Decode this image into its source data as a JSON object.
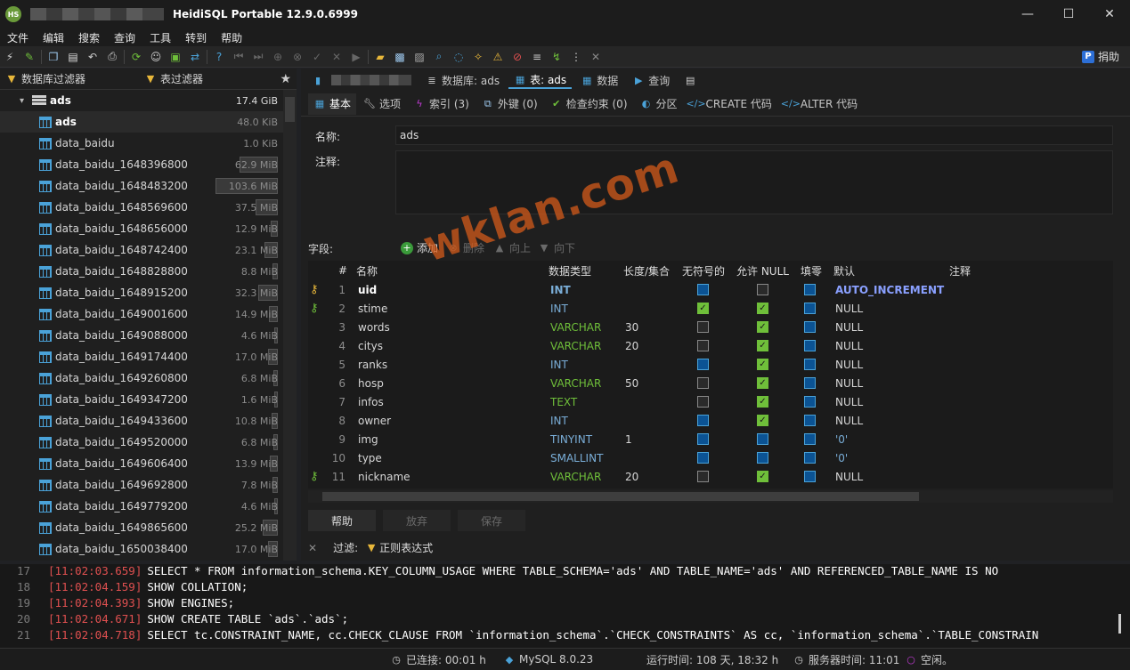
{
  "window": {
    "title": "HeidiSQL Portable 12.9.0.6999",
    "app_icon_text": "HS",
    "minimize": "—",
    "maximize": "☐",
    "close": "✕"
  },
  "menu": [
    "文件",
    "编辑",
    "搜索",
    "查询",
    "工具",
    "转到",
    "帮助"
  ],
  "toolbar": {
    "donate_label": "捐助",
    "paypal_text": "P"
  },
  "left": {
    "db_filter_label": "数据库过滤器",
    "table_filter_label": "表过滤器",
    "database": {
      "name": "ads",
      "size": "17.4 GiB"
    },
    "tables": [
      {
        "name": "ads",
        "size": "48.0 KiB",
        "fill": 0
      },
      {
        "name": "data_baidu",
        "size": "1.0 KiB",
        "fill": 0
      },
      {
        "name": "data_baidu_1648396800",
        "size": "62.9 MiB",
        "fill": 0.61
      },
      {
        "name": "data_baidu_1648483200",
        "size": "103.6 MiB",
        "fill": 1.0
      },
      {
        "name": "data_baidu_1648569600",
        "size": "37.5 MiB",
        "fill": 0.36
      },
      {
        "name": "data_baidu_1648656000",
        "size": "12.9 MiB",
        "fill": 0.12
      },
      {
        "name": "data_baidu_1648742400",
        "size": "23.1 MiB",
        "fill": 0.22
      },
      {
        "name": "data_baidu_1648828800",
        "size": "8.8 MiB",
        "fill": 0.08
      },
      {
        "name": "data_baidu_1648915200",
        "size": "32.3 MiB",
        "fill": 0.31
      },
      {
        "name": "data_baidu_1649001600",
        "size": "14.9 MiB",
        "fill": 0.14
      },
      {
        "name": "data_baidu_1649088000",
        "size": "4.6 MiB",
        "fill": 0.04
      },
      {
        "name": "data_baidu_1649174400",
        "size": "17.0 MiB",
        "fill": 0.16
      },
      {
        "name": "data_baidu_1649260800",
        "size": "6.8 MiB",
        "fill": 0.07
      },
      {
        "name": "data_baidu_1649347200",
        "size": "1.6 MiB",
        "fill": 0.02
      },
      {
        "name": "data_baidu_1649433600",
        "size": "10.8 MiB",
        "fill": 0.1
      },
      {
        "name": "data_baidu_1649520000",
        "size": "6.8 MiB",
        "fill": 0.07
      },
      {
        "name": "data_baidu_1649606400",
        "size": "13.9 MiB",
        "fill": 0.13
      },
      {
        "name": "data_baidu_1649692800",
        "size": "7.8 MiB",
        "fill": 0.08
      },
      {
        "name": "data_baidu_1649779200",
        "size": "4.6 MiB",
        "fill": 0.04
      },
      {
        "name": "data_baidu_1649865600",
        "size": "25.2 MiB",
        "fill": 0.24
      },
      {
        "name": "data_baidu_1650038400",
        "size": "17.0 MiB",
        "fill": 0.16
      }
    ]
  },
  "tabs1": {
    "database": "数据库: ads",
    "table": "表: ads",
    "data": "数据",
    "query": "查询"
  },
  "tabs2": {
    "basic": "基本",
    "options": "选项",
    "indexes": "索引 (3)",
    "foreign": "外键 (0)",
    "check": "检查约束 (0)",
    "partition": "分区",
    "create": "CREATE 代码",
    "alter": "ALTER 代码"
  },
  "form": {
    "name_label": "名称:",
    "name_value": "ads",
    "comment_label": "注释:",
    "fields_label": "字段:"
  },
  "field_buttons": {
    "add": "添加",
    "remove": "删除",
    "up": "向上",
    "down": "向下"
  },
  "grid": {
    "headers": {
      "num": "#",
      "name": "名称",
      "type": "数据类型",
      "length": "长度/集合",
      "unsigned": "无符号的",
      "null": "允许 NULL",
      "zerofill": "填零",
      "default": "默认",
      "comment": "注释"
    },
    "rows": [
      {
        "num": "1",
        "key": "primary",
        "name": "uid",
        "type": "INT",
        "type_color": "#7aaed8",
        "length": "",
        "unsigned": false,
        "unsigned_blue": true,
        "allow_null": false,
        "null_blue": false,
        "zerofill": false,
        "default": "AUTO_INCREMENT",
        "default_color": "#8aa0ff"
      },
      {
        "num": "2",
        "key": "index",
        "name": "stime",
        "type": "INT",
        "type_color": "#7aaed8",
        "length": "",
        "unsigned": true,
        "unsigned_blue": false,
        "allow_null": true,
        "null_blue": false,
        "zerofill": false,
        "default": "NULL",
        "default_color": "#d6d6d6"
      },
      {
        "num": "3",
        "key": "",
        "name": "words",
        "type": "VARCHAR",
        "type_color": "#6fbf3a",
        "length": "30",
        "unsigned": false,
        "unsigned_blue": false,
        "allow_null": true,
        "null_blue": false,
        "zerofill": false,
        "default": "NULL",
        "default_color": "#d6d6d6"
      },
      {
        "num": "4",
        "key": "",
        "name": "citys",
        "type": "VARCHAR",
        "type_color": "#6fbf3a",
        "length": "20",
        "unsigned": false,
        "unsigned_blue": false,
        "allow_null": true,
        "null_blue": false,
        "zerofill": false,
        "default": "NULL",
        "default_color": "#d6d6d6"
      },
      {
        "num": "5",
        "key": "",
        "name": "ranks",
        "type": "INT",
        "type_color": "#7aaed8",
        "length": "",
        "unsigned": false,
        "unsigned_blue": true,
        "allow_null": true,
        "null_blue": false,
        "zerofill": false,
        "default": "NULL",
        "default_color": "#d6d6d6"
      },
      {
        "num": "6",
        "key": "",
        "name": "hosp",
        "type": "VARCHAR",
        "type_color": "#6fbf3a",
        "length": "50",
        "unsigned": false,
        "unsigned_blue": false,
        "allow_null": true,
        "null_blue": false,
        "zerofill": false,
        "default": "NULL",
        "default_color": "#d6d6d6"
      },
      {
        "num": "7",
        "key": "",
        "name": "infos",
        "type": "TEXT",
        "type_color": "#6fbf3a",
        "length": "",
        "unsigned": false,
        "unsigned_blue": false,
        "allow_null": true,
        "null_blue": false,
        "zerofill": false,
        "default": "NULL",
        "default_color": "#d6d6d6"
      },
      {
        "num": "8",
        "key": "",
        "name": "owner",
        "type": "INT",
        "type_color": "#7aaed8",
        "length": "",
        "unsigned": false,
        "unsigned_blue": true,
        "allow_null": true,
        "null_blue": false,
        "zerofill": false,
        "default": "NULL",
        "default_color": "#d6d6d6"
      },
      {
        "num": "9",
        "key": "",
        "name": "img",
        "type": "TINYINT",
        "type_color": "#7aaed8",
        "length": "1",
        "unsigned": false,
        "unsigned_blue": true,
        "allow_null": false,
        "null_blue": true,
        "zerofill": false,
        "default": "'0'",
        "default_color": "#7aaed8"
      },
      {
        "num": "10",
        "key": "",
        "name": "type",
        "type": "SMALLINT",
        "type_color": "#7aaed8",
        "length": "",
        "unsigned": false,
        "unsigned_blue": true,
        "allow_null": false,
        "null_blue": true,
        "zerofill": false,
        "default": "'0'",
        "default_color": "#7aaed8"
      },
      {
        "num": "11",
        "key": "index",
        "name": "nickname",
        "type": "VARCHAR",
        "type_color": "#6fbf3a",
        "length": "20",
        "unsigned": false,
        "unsigned_blue": false,
        "allow_null": true,
        "null_blue": false,
        "zerofill": false,
        "default": "NULL",
        "default_color": "#d6d6d6"
      }
    ]
  },
  "bottom_buttons": {
    "help": "帮助",
    "discard": "放弃",
    "save": "保存"
  },
  "filter": {
    "label": "过滤:",
    "regex": "正则表达式"
  },
  "log": [
    {
      "num": "17",
      "ts": "[11:02:03.659]",
      "sql": "SELECT * FROM information_schema.KEY_COLUMN_USAGE WHERE   TABLE_SCHEMA='ads'   AND TABLE_NAME='ads'   AND REFERENCED_TABLE_NAME IS NO"
    },
    {
      "num": "18",
      "ts": "[11:02:04.159]",
      "sql": "SHOW COLLATION;"
    },
    {
      "num": "19",
      "ts": "[11:02:04.393]",
      "sql": "SHOW ENGINES;"
    },
    {
      "num": "20",
      "ts": "[11:02:04.671]",
      "sql": "SHOW CREATE TABLE `ads`.`ads`;"
    },
    {
      "num": "21",
      "ts": "[11:02:04.718]",
      "sql": "SELECT tc.CONSTRAINT_NAME, cc.CHECK_CLAUSE FROM `information_schema`.`CHECK_CONSTRAINTS` AS cc, `information_schema`.`TABLE_CONSTRAIN"
    }
  ],
  "status": {
    "connected": "已连接: 00:01 h",
    "server": "MySQL 8.0.23",
    "uptime": "运行时间: 108 天, 18:32 h",
    "server_time": "服务器时间: 11:01",
    "idle": "空闲。"
  },
  "watermark": "wklan.com"
}
